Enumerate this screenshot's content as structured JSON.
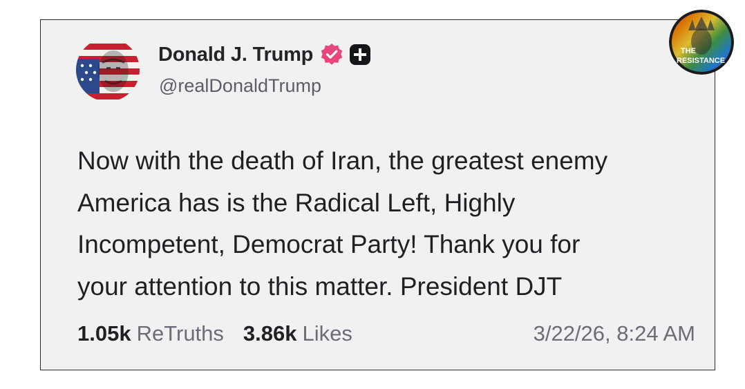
{
  "post": {
    "author_name": "Donald J. Trump",
    "handle": "@realDonaldTrump",
    "verified_icon": "verified-badge-icon",
    "plus_icon": "plus-badge-icon",
    "text_lines": [
      "Now with the death of Iran, the greatest enemy",
      "America has is the Radical Left, Highly",
      "Incompetent, Democrat Party! Thank you for",
      "your attention to this matter. President DJT"
    ],
    "retruths_count": "1.05k",
    "retruths_label": "ReTruths",
    "likes_count": "3.86k",
    "likes_label": "Likes",
    "timestamp": "3/22/26, 8:24 AM"
  },
  "watermark": {
    "line1": "THE",
    "line2": "RESISTANCE"
  },
  "colors": {
    "card_background": "#f1f1f2",
    "text_primary": "#1f2024",
    "text_secondary": "#6a6d75",
    "verified_badge": "#e8457a"
  }
}
